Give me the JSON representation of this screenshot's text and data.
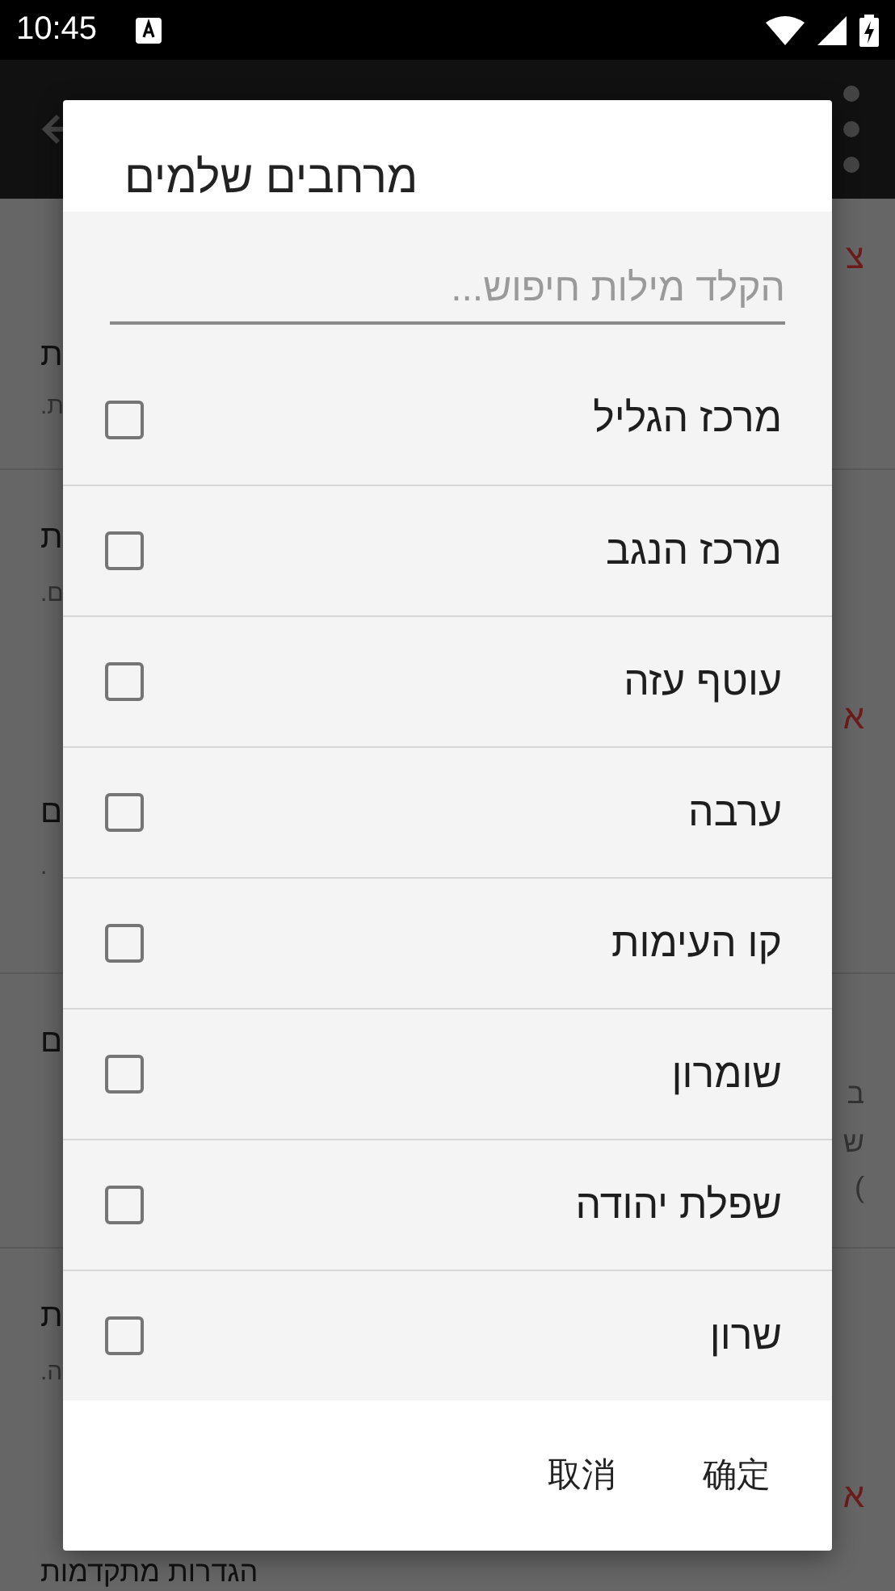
{
  "status_bar": {
    "time": "10:45"
  },
  "background": {
    "rows": [
      {
        "lines": [
          {
            "kind": "link",
            "text": "צ"
          },
          {
            "kind": "title",
            "text": "ת"
          },
          {
            "kind": "sub",
            "text": "ת."
          }
        ]
      },
      {
        "lines": [
          {
            "kind": "title",
            "text": "ת"
          },
          {
            "kind": "sub",
            "text": "ם."
          },
          {
            "kind": "link",
            "text": "א"
          },
          {
            "kind": "title",
            "text": "ם"
          },
          {
            "kind": "sub",
            "text": "."
          }
        ]
      },
      {
        "lines": [
          {
            "kind": "title",
            "text": "ם"
          },
          {
            "kind": "body",
            "text": "ב"
          },
          {
            "kind": "body",
            "text": "ש"
          },
          {
            "kind": "body",
            "text": "("
          }
        ]
      },
      {
        "lines": [
          {
            "kind": "title",
            "text": "ת"
          },
          {
            "kind": "sub",
            "text": "ה."
          },
          {
            "kind": "link",
            "text": "א"
          },
          {
            "kind": "title",
            "text": "הגדרות מתקדמות"
          }
        ]
      }
    ]
  },
  "dialog": {
    "title": "מרחבים שלמים",
    "search": {
      "placeholder": "הקלד מילות חיפוש..."
    },
    "items": [
      {
        "label": "מרכז הגליל",
        "checked": false
      },
      {
        "label": "מרכז הנגב",
        "checked": false
      },
      {
        "label": "עוטף עזה",
        "checked": false
      },
      {
        "label": "ערבה",
        "checked": false
      },
      {
        "label": "קו העימות",
        "checked": false
      },
      {
        "label": "שומרון",
        "checked": false
      },
      {
        "label": "שפלת יהודה",
        "checked": false
      },
      {
        "label": "שרון",
        "checked": false
      }
    ],
    "buttons": [
      {
        "label": "确定"
      },
      {
        "label": "取消"
      }
    ]
  }
}
